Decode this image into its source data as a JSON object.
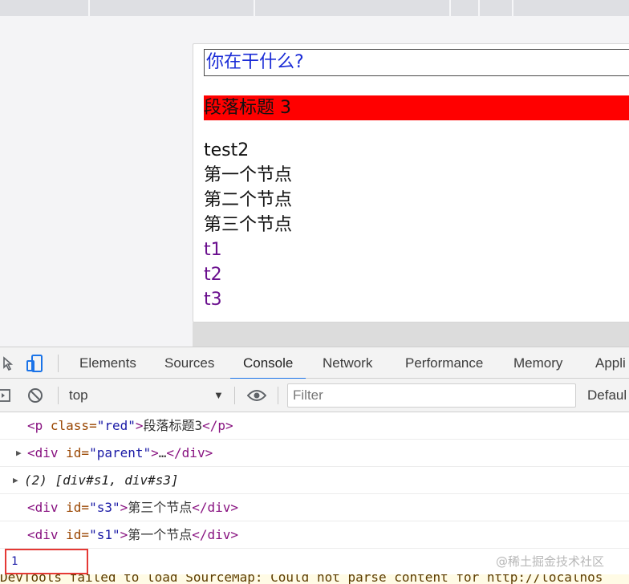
{
  "page": {
    "input_value": "你在干什么?",
    "red_paragraph": "段落标题 3",
    "lines": [
      "test2",
      "第一个节点",
      "第二个节点",
      "第三个节点"
    ],
    "links": [
      "t1",
      "t2",
      "t3"
    ]
  },
  "devtools": {
    "tabs": [
      "Elements",
      "Sources",
      "Console",
      "Network",
      "Performance",
      "Memory",
      "Appli"
    ],
    "active_tab": "Console",
    "context": "top",
    "filter_placeholder": "Filter",
    "levels": "Defaul",
    "console": {
      "row1": {
        "tag_open": "<p",
        "attr": " class=",
        "val": "\"red\"",
        "close": ">",
        "text": "段落标题3",
        "tag_close": "</p>"
      },
      "row2": {
        "tag_open": "<div",
        "attr": " id=",
        "val": "\"parent\"",
        "close": ">",
        "text": "…",
        "tag_close": "</div>"
      },
      "row3": {
        "text": "(2) [div#s1, div#s3]"
      },
      "row4": {
        "tag_open": "<div",
        "attr": " id=",
        "val": "\"s3\"",
        "close": ">",
        "text": "第三个节点",
        "tag_close": "</div>"
      },
      "row5": {
        "tag_open": "<div",
        "attr": " id=",
        "val": "\"s1\"",
        "close": ">",
        "text": "第一个节点",
        "tag_close": "</div>"
      },
      "result": "1",
      "warning": "DevTools failed to load SourceMap: Could not parse content for http://localhos"
    },
    "watermark": "@稀土掘金技术社区"
  }
}
